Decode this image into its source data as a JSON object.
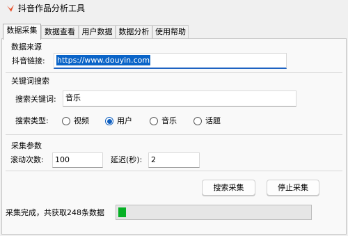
{
  "window": {
    "title": "抖音作品分析工具",
    "icon": "app-logo-icon",
    "accent_color": "#e8502a"
  },
  "tabs": [
    {
      "label": "数据采集",
      "active": true
    },
    {
      "label": "数据查看",
      "active": false
    },
    {
      "label": "用户数据",
      "active": false
    },
    {
      "label": "数据分析",
      "active": false
    },
    {
      "label": "使用帮助",
      "active": false
    }
  ],
  "source": {
    "group_title": "数据来源",
    "link_label": "抖音链接:",
    "link_value": "https://www.douyin.com"
  },
  "keyword": {
    "group_title": "关键词搜索",
    "keyword_label": "搜索关键词:",
    "keyword_value": "音乐",
    "type_label": "搜索类型:",
    "types": [
      {
        "label": "视频",
        "checked": false
      },
      {
        "label": "用户",
        "checked": true
      },
      {
        "label": "音乐",
        "checked": false
      },
      {
        "label": "话题",
        "checked": false
      }
    ]
  },
  "params": {
    "group_title": "采集参数",
    "scroll_label": "滚动次数:",
    "scroll_value": "100",
    "delay_label": "延迟(秒):",
    "delay_value": "2"
  },
  "actions": {
    "search_label": "搜索采集",
    "stop_label": "停止采集"
  },
  "status": {
    "message": "采集完成，共获取248条数据",
    "progress_fraction": 0.04,
    "progress_color": "#06b025"
  }
}
